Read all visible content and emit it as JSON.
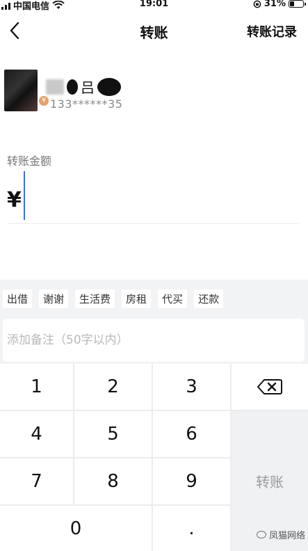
{
  "status_bar": {
    "carrier": "中国电信",
    "time": "19:01",
    "battery": "31%"
  },
  "nav": {
    "title": "转账",
    "right_link": "转账记录"
  },
  "recipient": {
    "name_visible": "吕",
    "phone": "133******35",
    "badge": "¥"
  },
  "amount": {
    "label": "转账金额",
    "currency": "¥"
  },
  "quick_tags": [
    "出借",
    "谢谢",
    "生活费",
    "房租",
    "代买",
    "还款"
  ],
  "note": {
    "placeholder": "添加备注（50字以内）"
  },
  "keypad": {
    "keys": [
      "1",
      "2",
      "3",
      "4",
      "5",
      "6",
      "7",
      "8",
      "9",
      "0",
      "."
    ],
    "transfer_label": "转账"
  },
  "watermark": "凤猫网络"
}
